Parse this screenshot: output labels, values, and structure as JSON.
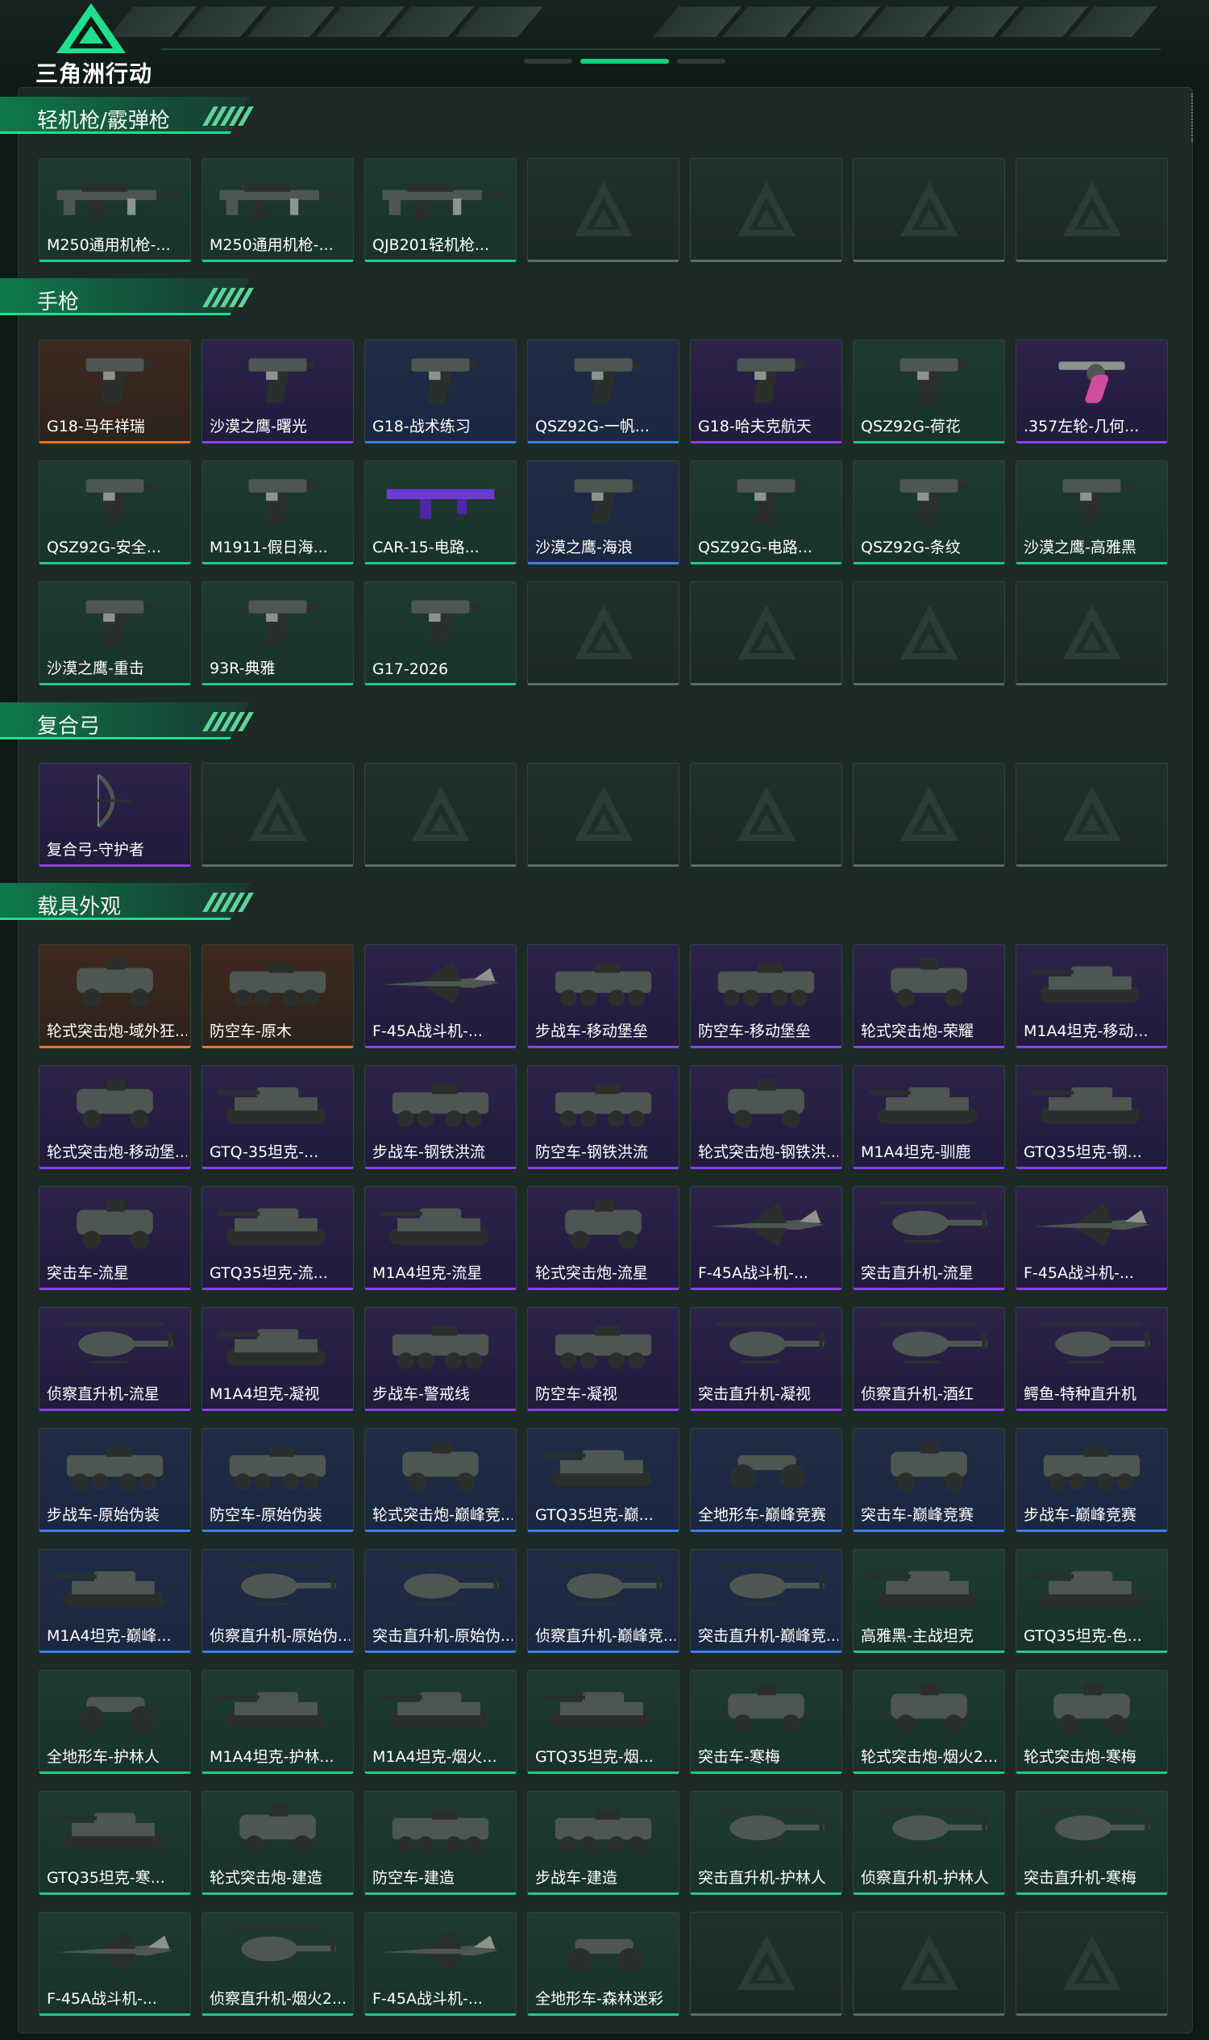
{
  "app": {
    "logo_text": "三角洲行动"
  },
  "colors": {
    "accent": "#1ee08c",
    "green": "#28c77e",
    "blue": "#3b7de8",
    "purple": "#8a3ff0",
    "orange": "#e8762a"
  },
  "sections": [
    {
      "title": "轻机枪/霰弹枪",
      "items": [
        {
          "label": "M250通用机枪-...",
          "quality": "green",
          "icon": "machine-gun"
        },
        {
          "label": "M250通用机枪-...",
          "quality": "green",
          "icon": "machine-gun"
        },
        {
          "label": "QJB201轻机枪...",
          "quality": "green",
          "icon": "machine-gun"
        },
        {
          "empty": true
        },
        {
          "empty": true
        },
        {
          "empty": true
        },
        {
          "empty": true
        }
      ]
    },
    {
      "title": "手枪",
      "items": [
        {
          "label": "G18-马年祥瑞",
          "quality": "orange",
          "icon": "pistol"
        },
        {
          "label": "沙漠之鹰-曙光",
          "quality": "purple",
          "icon": "pistol"
        },
        {
          "label": "G18-战术练习",
          "quality": "blue",
          "icon": "pistol"
        },
        {
          "label": "QSZ92G-一帆...",
          "quality": "blue",
          "icon": "pistol"
        },
        {
          "label": "G18-哈夫克航天",
          "quality": "purple",
          "icon": "pistol"
        },
        {
          "label": "QSZ92G-荷花",
          "quality": "green",
          "icon": "pistol"
        },
        {
          "label": ".357左轮-几何...",
          "quality": "purple",
          "icon": "revolver"
        },
        {
          "label": "QSZ92G-安全...",
          "quality": "green",
          "icon": "pistol"
        },
        {
          "label": "M1911-假日海...",
          "quality": "green",
          "icon": "pistol"
        },
        {
          "label": "CAR-15-电路...",
          "quality": "green",
          "icon": "rifle"
        },
        {
          "label": "沙漠之鹰-海浪",
          "quality": "blue",
          "icon": "pistol"
        },
        {
          "label": "QSZ92G-电路...",
          "quality": "green",
          "icon": "pistol"
        },
        {
          "label": "QSZ92G-条纹",
          "quality": "green",
          "icon": "pistol"
        },
        {
          "label": "沙漠之鹰-高雅黑",
          "quality": "green",
          "icon": "pistol"
        },
        {
          "label": "沙漠之鹰-重击",
          "quality": "green",
          "icon": "pistol"
        },
        {
          "label": "93R-典雅",
          "quality": "green",
          "icon": "pistol"
        },
        {
          "label": "G17-2026",
          "quality": "green",
          "icon": "pistol"
        },
        {
          "empty": true
        },
        {
          "empty": true
        },
        {
          "empty": true
        },
        {
          "empty": true
        }
      ]
    },
    {
      "title": "复合弓",
      "items": [
        {
          "label": "复合弓-守护者",
          "quality": "purple",
          "icon": "bow"
        },
        {
          "empty": true
        },
        {
          "empty": true
        },
        {
          "empty": true
        },
        {
          "empty": true
        },
        {
          "empty": true
        },
        {
          "empty": true
        }
      ]
    },
    {
      "title": "载具外观",
      "items": [
        {
          "label": "轮式突击炮-域外狂...",
          "quality": "orange",
          "icon": "armored-car"
        },
        {
          "label": "防空车-原木",
          "quality": "orange",
          "icon": "apc"
        },
        {
          "label": "F-45A战斗机-...",
          "quality": "purple",
          "icon": "jet"
        },
        {
          "label": "步战车-移动堡垒",
          "quality": "purple",
          "icon": "apc"
        },
        {
          "label": "防空车-移动堡垒",
          "quality": "purple",
          "icon": "apc"
        },
        {
          "label": "轮式突击炮-荣耀",
          "quality": "purple",
          "icon": "armored-car"
        },
        {
          "label": "M1A4坦克-移动...",
          "quality": "purple",
          "icon": "tank"
        },
        {
          "label": "轮式突击炮-移动堡...",
          "quality": "purple",
          "icon": "armored-car"
        },
        {
          "label": "GTQ-35坦克-...",
          "quality": "purple",
          "icon": "tank"
        },
        {
          "label": "步战车-钢铁洪流",
          "quality": "purple",
          "icon": "apc"
        },
        {
          "label": "防空车-钢铁洪流",
          "quality": "purple",
          "icon": "apc"
        },
        {
          "label": "轮式突击炮-钢铁洪...",
          "quality": "purple",
          "icon": "armored-car"
        },
        {
          "label": "M1A4坦克-驯鹿",
          "quality": "purple",
          "icon": "tank"
        },
        {
          "label": "GTQ35坦克-钢...",
          "quality": "purple",
          "icon": "tank"
        },
        {
          "label": "突击车-流星",
          "quality": "purple",
          "icon": "armored-car"
        },
        {
          "label": "GTQ35坦克-流...",
          "quality": "purple",
          "icon": "tank"
        },
        {
          "label": "M1A4坦克-流星",
          "quality": "purple",
          "icon": "tank"
        },
        {
          "label": "轮式突击炮-流星",
          "quality": "purple",
          "icon": "armored-car"
        },
        {
          "label": "F-45A战斗机-...",
          "quality": "purple",
          "icon": "jet"
        },
        {
          "label": "突击直升机-流星",
          "quality": "purple",
          "icon": "helicopter"
        },
        {
          "label": "F-45A战斗机-...",
          "quality": "purple",
          "icon": "jet"
        },
        {
          "label": "侦察直升机-流星",
          "quality": "purple",
          "icon": "helicopter"
        },
        {
          "label": "M1A4坦克-凝视",
          "quality": "purple",
          "icon": "tank"
        },
        {
          "label": "步战车-警戒线",
          "quality": "purple",
          "icon": "apc"
        },
        {
          "label": "防空车-凝视",
          "quality": "purple",
          "icon": "apc"
        },
        {
          "label": "突击直升机-凝视",
          "quality": "purple",
          "icon": "helicopter"
        },
        {
          "label": "侦察直升机-酒红",
          "quality": "purple",
          "icon": "helicopter"
        },
        {
          "label": "鳄鱼-特种直升机",
          "quality": "purple",
          "icon": "helicopter"
        },
        {
          "label": "步战车-原始伪装",
          "quality": "blue",
          "icon": "apc"
        },
        {
          "label": "防空车-原始伪装",
          "quality": "blue",
          "icon": "apc"
        },
        {
          "label": "轮式突击炮-巅峰竞...",
          "quality": "blue",
          "icon": "armored-car"
        },
        {
          "label": "GTQ35坦克-巅...",
          "quality": "blue",
          "icon": "tank"
        },
        {
          "label": "全地形车-巅峰竞赛",
          "quality": "blue",
          "icon": "atv"
        },
        {
          "label": "突击车-巅峰竞赛",
          "quality": "blue",
          "icon": "armored-car"
        },
        {
          "label": "步战车-巅峰竞赛",
          "quality": "blue",
          "icon": "apc"
        },
        {
          "label": "M1A4坦克-巅峰...",
          "quality": "blue",
          "icon": "tank"
        },
        {
          "label": "侦察直升机-原始伪...",
          "quality": "blue",
          "icon": "helicopter"
        },
        {
          "label": "突击直升机-原始伪...",
          "quality": "blue",
          "icon": "helicopter"
        },
        {
          "label": "侦察直升机-巅峰竞...",
          "quality": "blue",
          "icon": "helicopter"
        },
        {
          "label": "突击直升机-巅峰竞...",
          "quality": "blue",
          "icon": "helicopter"
        },
        {
          "label": "高雅黑-主战坦克",
          "quality": "green",
          "icon": "tank"
        },
        {
          "label": "GTQ35坦克-色...",
          "quality": "green",
          "icon": "tank"
        },
        {
          "label": "全地形车-护林人",
          "quality": "green",
          "icon": "atv"
        },
        {
          "label": "M1A4坦克-护林...",
          "quality": "green",
          "icon": "tank"
        },
        {
          "label": "M1A4坦克-烟火...",
          "quality": "green",
          "icon": "tank"
        },
        {
          "label": "GTQ35坦克-烟...",
          "quality": "green",
          "icon": "tank"
        },
        {
          "label": "突击车-寒梅",
          "quality": "green",
          "icon": "armored-car"
        },
        {
          "label": "轮式突击炮-烟火2...",
          "quality": "green",
          "icon": "armored-car"
        },
        {
          "label": "轮式突击炮-寒梅",
          "quality": "green",
          "icon": "armored-car"
        },
        {
          "label": "GTQ35坦克-寒...",
          "quality": "green",
          "icon": "tank"
        },
        {
          "label": "轮式突击炮-建造",
          "quality": "green",
          "icon": "armored-car"
        },
        {
          "label": "防空车-建造",
          "quality": "green",
          "icon": "apc"
        },
        {
          "label": "步战车-建造",
          "quality": "green",
          "icon": "apc"
        },
        {
          "label": "突击直升机-护林人",
          "quality": "green",
          "icon": "helicopter"
        },
        {
          "label": "侦察直升机-护林人",
          "quality": "green",
          "icon": "helicopter"
        },
        {
          "label": "突击直升机-寒梅",
          "quality": "green",
          "icon": "helicopter"
        },
        {
          "label": "F-45A战斗机-...",
          "quality": "green",
          "icon": "jet"
        },
        {
          "label": "侦察直升机-烟火2...",
          "quality": "green",
          "icon": "helicopter"
        },
        {
          "label": "F-45A战斗机-...",
          "quality": "green",
          "icon": "jet"
        },
        {
          "label": "全地形车-森林迷彩",
          "quality": "green",
          "icon": "atv"
        },
        {
          "empty": true
        },
        {
          "empty": true
        },
        {
          "empty": true
        }
      ]
    }
  ]
}
